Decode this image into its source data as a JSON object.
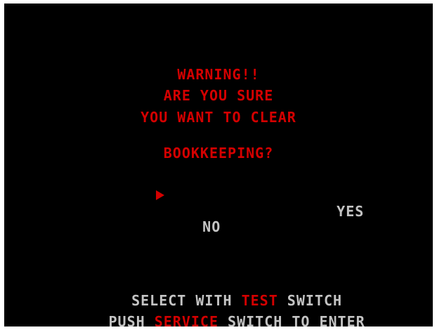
{
  "warning": {
    "line1": "WARNING!!",
    "line2": "ARE YOU SURE",
    "line3": "YOU WANT TO CLEAR",
    "line4": "BOOKKEEPING?"
  },
  "choices": {
    "no": "NO",
    "yes": "YES"
  },
  "instructions": {
    "line1_pre": "SELECT WITH ",
    "line1_key": "TEST",
    "line1_post": " SWITCH",
    "line2_pre": "PUSH ",
    "line2_key": "SERVICE",
    "line2_post": " SWITCH TO ENTER"
  },
  "colors": {
    "red": "#d40000",
    "gray": "#c4c4c4",
    "background": "#000000"
  }
}
